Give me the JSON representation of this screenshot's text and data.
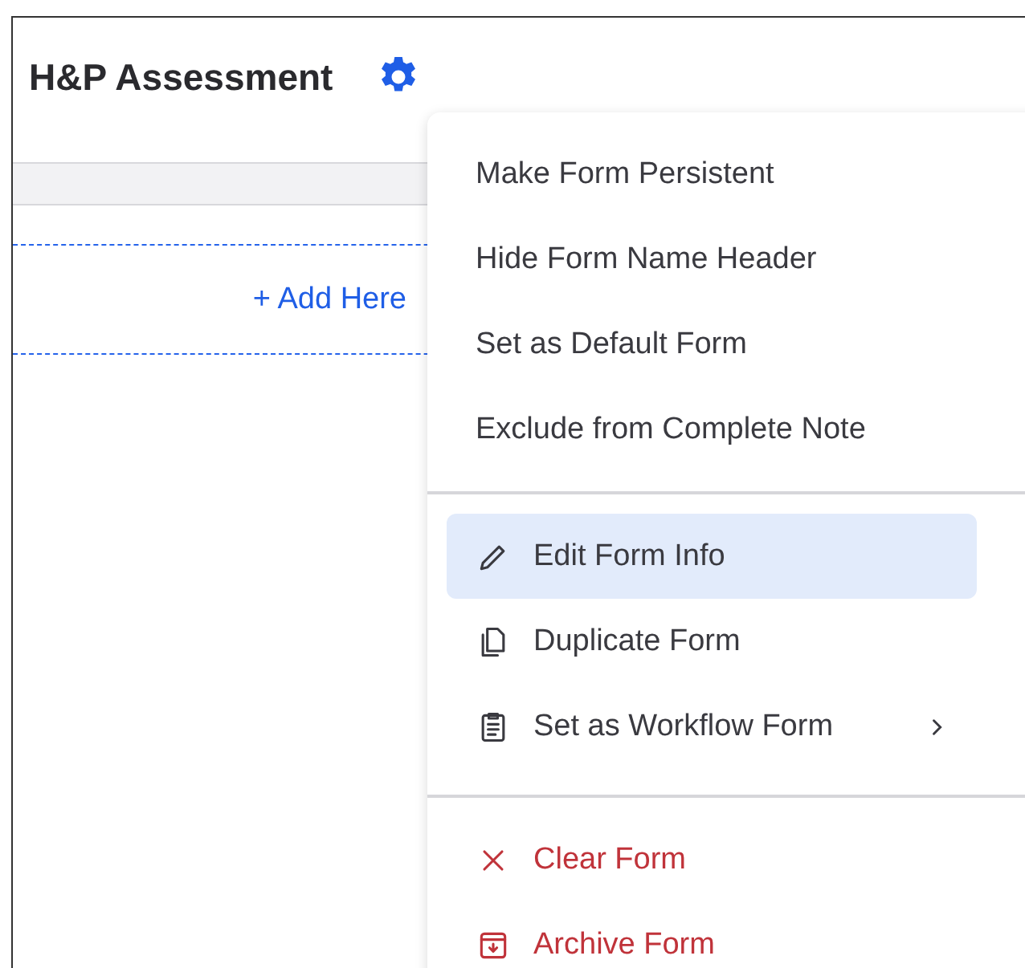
{
  "header": {
    "title": "H&P Assessment"
  },
  "drop_zone": {
    "label": "+ Add Here"
  },
  "menu": {
    "sections": [
      {
        "items": [
          {
            "label": "Make Form Persistent",
            "kind": "plain",
            "selected": false,
            "submenu": false
          },
          {
            "label": "Hide Form Name Header",
            "kind": "plain",
            "selected": false,
            "submenu": false
          },
          {
            "label": "Set as Default Form",
            "kind": "plain",
            "selected": false,
            "submenu": false
          },
          {
            "label": "Exclude from Complete Note",
            "kind": "plain",
            "selected": false,
            "submenu": false
          }
        ]
      },
      {
        "items": [
          {
            "label": "Edit Form Info",
            "kind": "pencil",
            "selected": true,
            "submenu": false
          },
          {
            "label": "Duplicate Form",
            "kind": "copy",
            "selected": false,
            "submenu": false
          },
          {
            "label": "Set as Workflow Form",
            "kind": "clipboard",
            "selected": false,
            "submenu": true
          }
        ]
      },
      {
        "items": [
          {
            "label": "Clear Form",
            "kind": "clear",
            "selected": false,
            "submenu": false
          },
          {
            "label": "Archive Form",
            "kind": "archive",
            "selected": false,
            "submenu": false
          }
        ]
      }
    ]
  }
}
